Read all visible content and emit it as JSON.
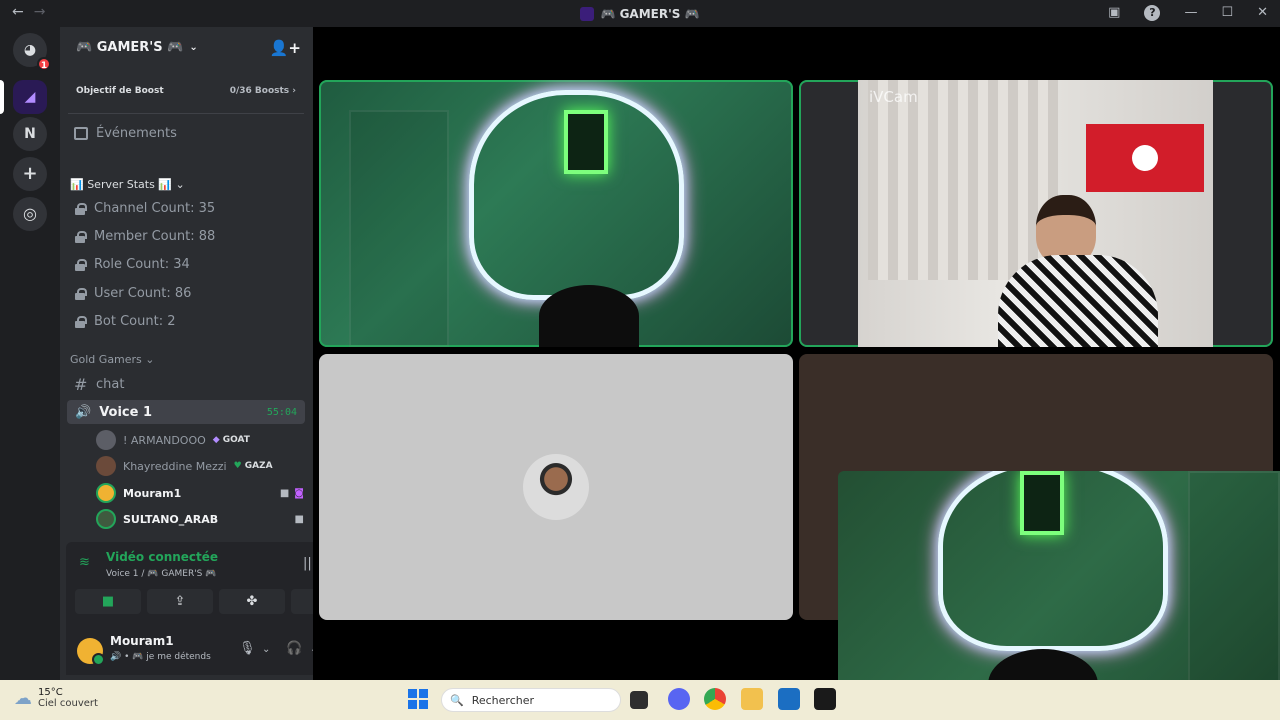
{
  "window": {
    "title": "🎮 GAMER'S 🎮",
    "back_glyph": "←",
    "forward_glyph": "→",
    "minimize_glyph": "—",
    "maximize_glyph": "☐",
    "close_glyph": "✕",
    "help_glyph": "?"
  },
  "rail": {
    "dm_badge": "1",
    "server_n_label": "N",
    "add_glyph": "+",
    "discover_glyph": "◎"
  },
  "guild": {
    "name": "🎮 GAMER'S 🎮",
    "chevron": "⌄",
    "invite_glyph": "👤+",
    "boost_label": "Objectif de Boost",
    "boost_progress": "0/36 Boosts ›",
    "events_label": "Événements"
  },
  "categories": {
    "stats": "📊 Server Stats 📊 ⌄",
    "gold": "Gold Gamers ⌄"
  },
  "stats_channels": [
    "Channel Count: 35",
    "Member Count: 88",
    "Role Count: 34",
    "User Count: 86",
    "Bot Count: 2"
  ],
  "text_channel": {
    "hash": "#",
    "name": "chat"
  },
  "voice_channel": {
    "speaker": "🔊",
    "name": "Voice 1",
    "time": "55:04"
  },
  "voice_users": [
    {
      "name": "! ARMANDOOO",
      "tag_icon": "◆",
      "tag": "GOAT"
    },
    {
      "name": "Khayreddine Mezzi",
      "tag_icon": "♥",
      "tag": "GAZA"
    },
    {
      "name": "Mouram1",
      "cam_icon": "■",
      "game_icon": "◙"
    },
    {
      "name": "SULTANO_ARAB",
      "cam_icon": "■"
    }
  ],
  "voice_panel": {
    "signal_glyph": "≋",
    "status": "Vidéo connectée",
    "sub": "Voice 1 / 🎮 GAMER'S 🎮",
    "wave_glyph": "|||",
    "hangup_glyph": "☎",
    "btn_camera": "■",
    "btn_screen": "⇪",
    "btn_activities": "✤",
    "btn_soundboard": "♫"
  },
  "user_panel": {
    "name": "Mouram1",
    "status": "🔊 • 🎮 je me détends",
    "mic_glyph": "🎙",
    "headset_glyph": "🎧",
    "settings_glyph": "⚙",
    "chev": "⌄"
  },
  "video": {
    "watermark": "iVCam"
  },
  "taskbar": {
    "temp": "15°C",
    "weather_desc": "Ciel couvert",
    "cloud_glyph": "☁",
    "search_glyph": "🔍",
    "search_placeholder": "Rechercher"
  },
  "colors": {
    "accent_green": "#23a55a",
    "sidebar_bg": "#2b2d31",
    "rail_bg": "#1e1f22"
  }
}
